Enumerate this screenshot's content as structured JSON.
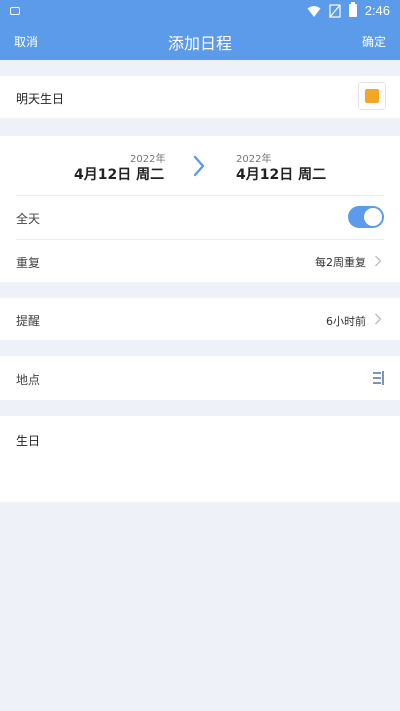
{
  "status_bar": {
    "time": "2:46",
    "icons": [
      "notification-icon",
      "wifi-icon",
      "no-signal-icon",
      "battery-icon"
    ]
  },
  "header": {
    "cancel_label": "取消",
    "title": "添加日程",
    "confirm_label": "确定"
  },
  "event": {
    "name": "明天生日",
    "color": "#f5a623"
  },
  "time": {
    "start_year": "2022年",
    "start_date": "4月12日 周二",
    "end_year": "2022年",
    "end_date": "4月12日 周二",
    "all_day_label": "全天",
    "all_day": true,
    "repeat_label": "重复",
    "repeat_value": "每2周重复"
  },
  "reminder": {
    "label": "提醒",
    "value": "6小时前"
  },
  "location": {
    "label": "地点",
    "value": ""
  },
  "note": {
    "text": "生日"
  },
  "colors": {
    "accent": "#5b9bea",
    "background": "#eef1f7"
  }
}
